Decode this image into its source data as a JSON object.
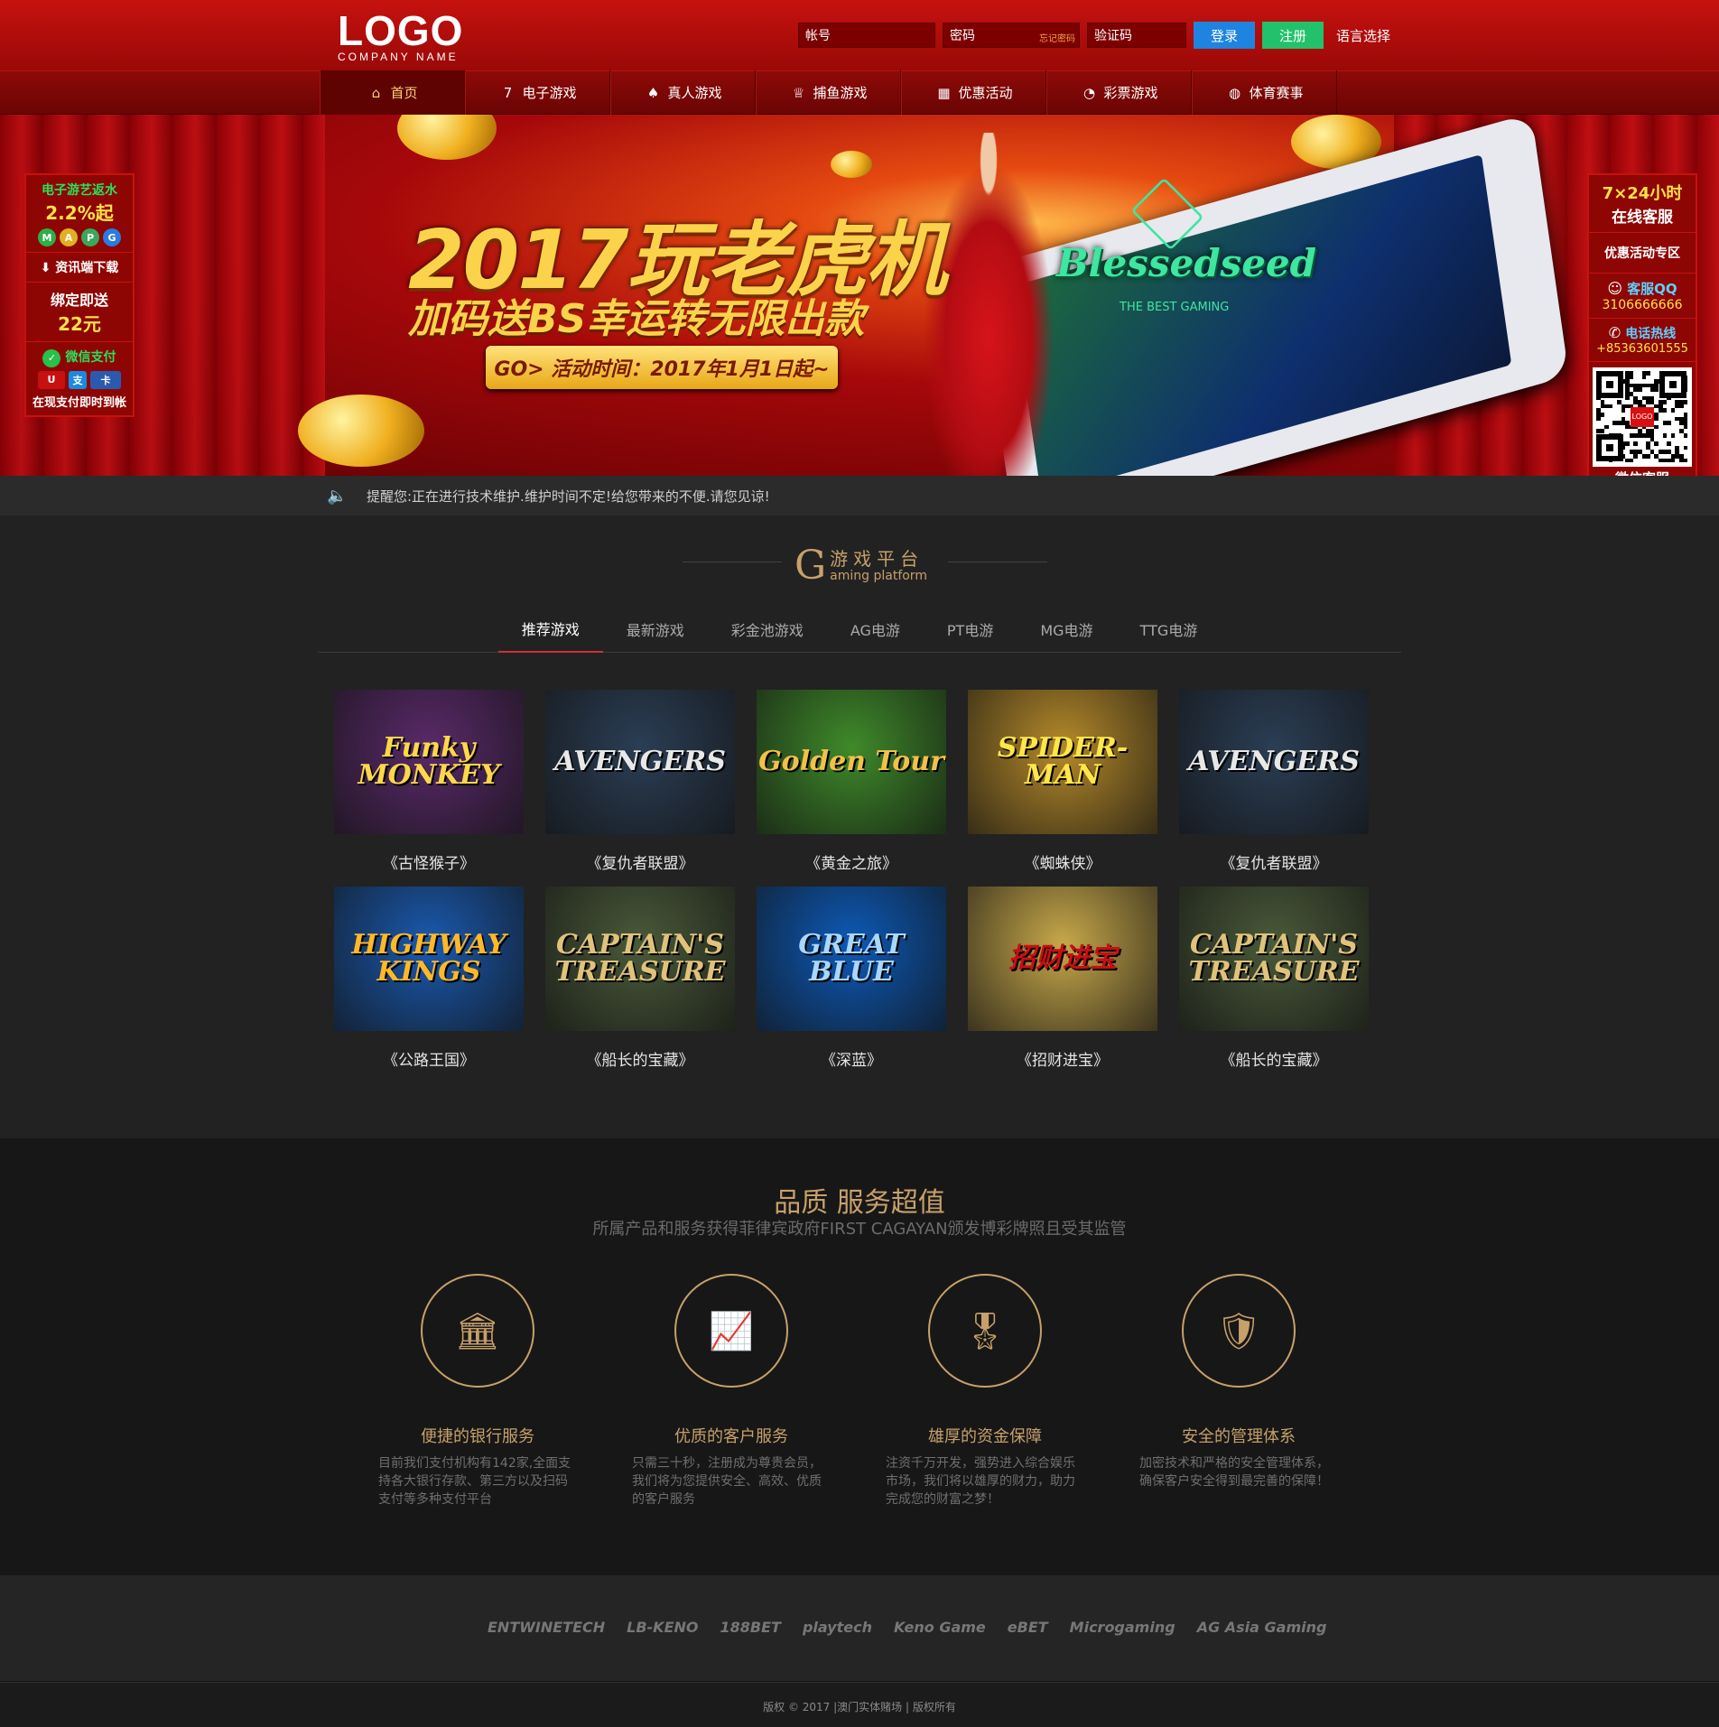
{
  "header": {
    "logo_main": "LOGO",
    "logo_sub": "COMPANY NAME",
    "account_placeholder": "帐号",
    "password_placeholder": "密码",
    "forgot_password": "忘记密码",
    "captcha_placeholder": "验证码",
    "login_label": "登录",
    "register_label": "注册",
    "language_label": "语言选择"
  },
  "nav": {
    "items": [
      {
        "label": "首页",
        "icon": "home-icon",
        "glyph": "⌂"
      },
      {
        "label": "电子游戏",
        "icon": "slot-777-icon",
        "glyph": "7"
      },
      {
        "label": "真人游戏",
        "icon": "cards-icon",
        "glyph": "♠"
      },
      {
        "label": "捕鱼游戏",
        "icon": "trophy-icon",
        "glyph": "♕"
      },
      {
        "label": "优惠活动",
        "icon": "gift-icon",
        "glyph": "▦"
      },
      {
        "label": "彩票游戏",
        "icon": "ball-icon",
        "glyph": "◔"
      },
      {
        "label": "体育赛事",
        "icon": "sports-ball-icon",
        "glyph": "◍"
      }
    ]
  },
  "banner": {
    "title": "2017玩老虎机",
    "subtitle": "加码送BS幸运转无限出款",
    "cta": "GO> 活动时间：2017年1月1日起~",
    "brand": "Blessedseed",
    "brand_tag": "THE BEST GAMING"
  },
  "left_panel": {
    "rebate_title": "电子游艺返水",
    "rebate_value": "2.2%起",
    "download": "资讯端下载",
    "bind_title": "绑定即送",
    "bind_value": "22元",
    "wechat": "微信支付",
    "pay_note": "在现支付即时到帐"
  },
  "right_panel": {
    "service_hours": "7×24小时",
    "service_online": "在线客服",
    "promo": "优惠活动专区",
    "qq_label": "客服QQ",
    "qq_number": "3106666666",
    "hotline_label": "电话热线",
    "hotline_number": "+85363601555",
    "qr_logo": "LOGO",
    "wechat_service": "微信客服"
  },
  "notice": {
    "text": "提醒您:正在进行技术维护.维护时间不定!给您带来的不便.请您见谅!"
  },
  "gaming": {
    "title_letter": "G",
    "title_cn": "游戏平台",
    "title_en": "aming platform",
    "tabs": [
      "推荐游戏",
      "最新游戏",
      "彩金池游戏",
      "AG电游",
      "PT电游",
      "MG电游",
      "TTG电游"
    ],
    "games": [
      {
        "name": "《古怪猴子》",
        "art": "Funky MONKEY",
        "bg": "#5a2a6a",
        "fg": "#ffd84a"
      },
      {
        "name": "《复仇者联盟》",
        "art": "AVENGERS",
        "bg": "#2b3e55",
        "fg": "#e8e8e8"
      },
      {
        "name": "《黄金之旅》",
        "art": "Golden Tour",
        "bg": "#3f8a2a",
        "fg": "#f2c14a"
      },
      {
        "name": "《蜘蛛侠》",
        "art": "SPIDER-MAN",
        "bg": "#b58a2a",
        "fg": "#ffe64a"
      },
      {
        "name": "《复仇者联盟》",
        "art": "AVENGERS",
        "bg": "#2b3e55",
        "fg": "#e8e8e8"
      },
      {
        "name": "《公路王国》",
        "art": "HIGHWAY KINGS",
        "bg": "#1a5ab0",
        "fg": "#ffb82a"
      },
      {
        "name": "《船长的宝藏》",
        "art": "CAPTAIN'S TREASURE",
        "bg": "#4a5a3a",
        "fg": "#e0c27a"
      },
      {
        "name": "《深蓝》",
        "art": "GREAT BLUE",
        "bg": "#0d5ab8",
        "fg": "#a8d8ff"
      },
      {
        "name": "《招财进宝》",
        "art": "招财进宝",
        "bg": "#c7a84a",
        "fg": "#c81010"
      },
      {
        "name": "《船长的宝藏》",
        "art": "CAPTAIN'S TREASURE",
        "bg": "#4a5a3a",
        "fg": "#e0c27a"
      }
    ]
  },
  "quality": {
    "title": "品质 服务超值",
    "subtitle": "所属产品和服务获得菲律宾政府FIRST CAGAYAN颁发博彩牌照且受其监管",
    "features": [
      {
        "icon": "bank-icon",
        "glyph": "🏛",
        "title": "便捷的银行服务",
        "desc": "目前我们支付机构有142家,全面支持各大银行存款、第三方以及扫码支付等多种支付平台"
      },
      {
        "icon": "chart-icon",
        "glyph": "📈",
        "title": "优质的客户服务",
        "desc": "只需三十秒，注册成为尊贵会员，我们将为您提供安全、高效、优质的客户服务"
      },
      {
        "icon": "medal-icon",
        "glyph": "🎖",
        "title": "雄厚的资金保障",
        "desc": "注资千万开发，强势进入综合娱乐市场，我们将以雄厚的财力，助力完成您的财富之梦！"
      },
      {
        "icon": "shield-icon",
        "glyph": "🛡",
        "title": "安全的管理体系",
        "desc": "加密技术和严格的安全管理体系，确保客户安全得到最完善的保障！"
      }
    ]
  },
  "partners": [
    "ENTWINETECH",
    "LB-KENO",
    "188BET",
    "playtech",
    "Keno Game",
    "eBET",
    "Microgaming",
    "AG Asia Gaming"
  ],
  "footer": {
    "copyright": "版权 © 2017 |澳门实体赌场 | 版权所有"
  }
}
